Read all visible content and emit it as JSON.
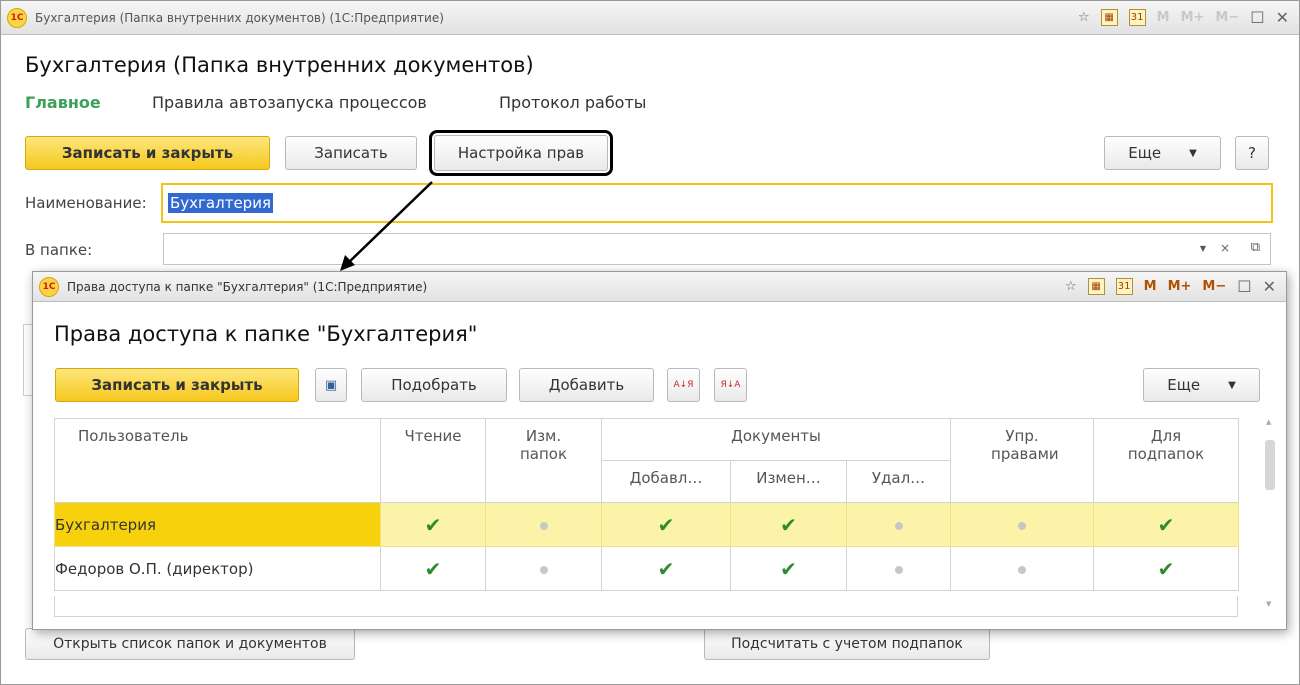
{
  "main": {
    "window_title": "Бухгалтерия (Папка внутренних документов)  (1С:Предприятие)",
    "title": "Бухгалтерия (Папка внутренних документов)",
    "tabs": [
      "Главное",
      "Правила автозапуска процессов",
      "Протокол работы"
    ],
    "toolbar": {
      "save_close": "Записать и закрыть",
      "save": "Записать",
      "rights": "Настройка прав",
      "more": "Еще",
      "help": "?"
    },
    "name_label": "Наименование:",
    "name_value": "Бухгалтерия",
    "folder_label": "В папке:",
    "bottom": {
      "open_list": "Открыть список папок и документов",
      "count": "Подсчитать с учетом подпапок"
    }
  },
  "titlebar_icons": {
    "m": "M",
    "mplus": "M+",
    "mminus": "M−",
    "calendar_day": "31"
  },
  "dialog": {
    "window_title": "Права доступа к папке \"Бухгалтерия\"  (1С:Предприятие)",
    "title": "Права доступа к папке \"Бухгалтерия\"",
    "toolbar": {
      "save_close": "Записать и закрыть",
      "pick": "Подобрать",
      "add": "Добавить",
      "more": "Еще"
    },
    "sort_icons": {
      "asc": "А↓Я",
      "desc": "Я↓А"
    },
    "headers": {
      "user": "Пользователь",
      "read": "Чтение",
      "folders": "Изм. папок",
      "documents": "Документы",
      "doc_add": "Добавл…",
      "doc_change": "Измен…",
      "doc_delete": "Удал…",
      "rights": "Упр. правами",
      "subfolders": "Для подпапок"
    },
    "rows": [
      {
        "user": "Бухгалтерия",
        "values": [
          true,
          false,
          true,
          true,
          false,
          false,
          true
        ]
      },
      {
        "user": "Федоров О.П. (директор)",
        "values": [
          true,
          false,
          true,
          true,
          false,
          false,
          true
        ]
      }
    ]
  }
}
